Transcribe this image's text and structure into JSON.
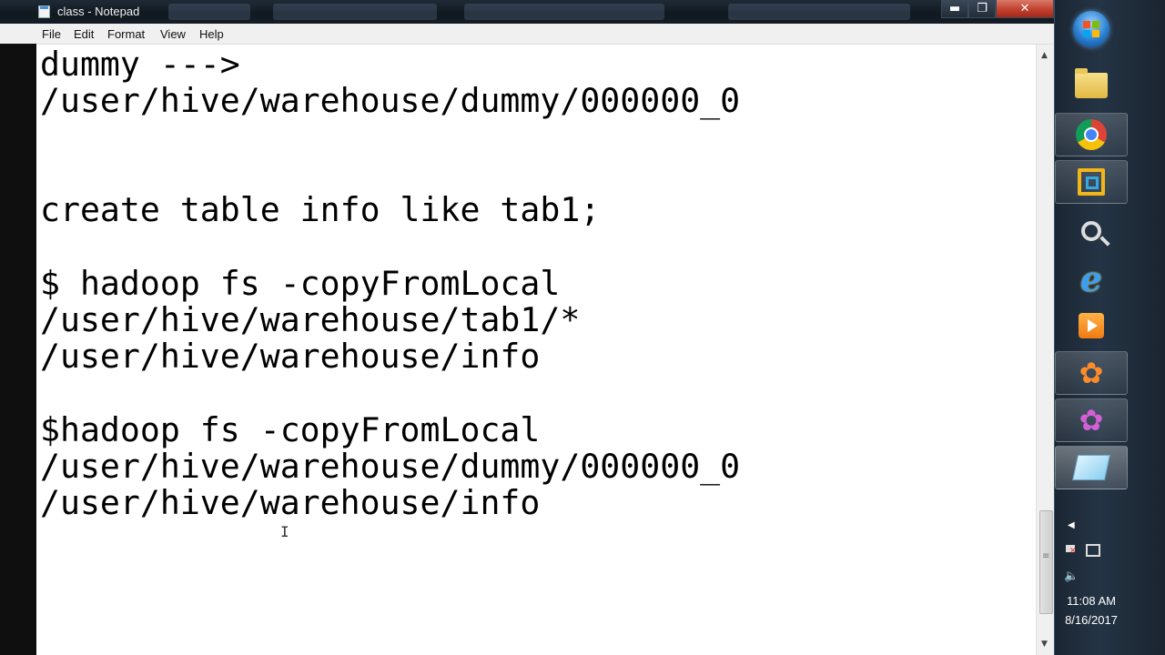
{
  "window": {
    "title": "class - Notepad",
    "min_glyph": "▬",
    "max_glyph": "❐",
    "close_glyph": "✕"
  },
  "menu": {
    "file": "File",
    "edit": "Edit",
    "format": "Format",
    "view": "View",
    "help": "Help"
  },
  "editor": {
    "lines": [
      "dummy --->",
      "/user/hive/warehouse/dummy/000000_0",
      "",
      "",
      "create table info like tab1;",
      "",
      "$ hadoop fs -copyFromLocal",
      "/user/hive/warehouse/tab1/*",
      "/user/hive/warehouse/info",
      "",
      "$hadoop fs -copyFromLocal",
      "/user/hive/warehouse/dummy/000000_0",
      "/user/hive/warehouse/info"
    ],
    "cursor_glyph": "I"
  },
  "scrollbar": {
    "up": "▲",
    "down": "▼"
  },
  "taskbar": {
    "pinned": [
      "start-orb",
      "windows-explorer",
      "google-chrome",
      "vmware",
      "search",
      "internet-explorer",
      "media-player",
      "app-orange",
      "app-purple",
      "notepad"
    ],
    "ie_glyph": "e",
    "flower_glyph": "✿",
    "tray_arrow": "◀",
    "volume_glyph": "🔈",
    "clock": {
      "time": "11:08 AM",
      "date": "8/16/2017"
    }
  }
}
